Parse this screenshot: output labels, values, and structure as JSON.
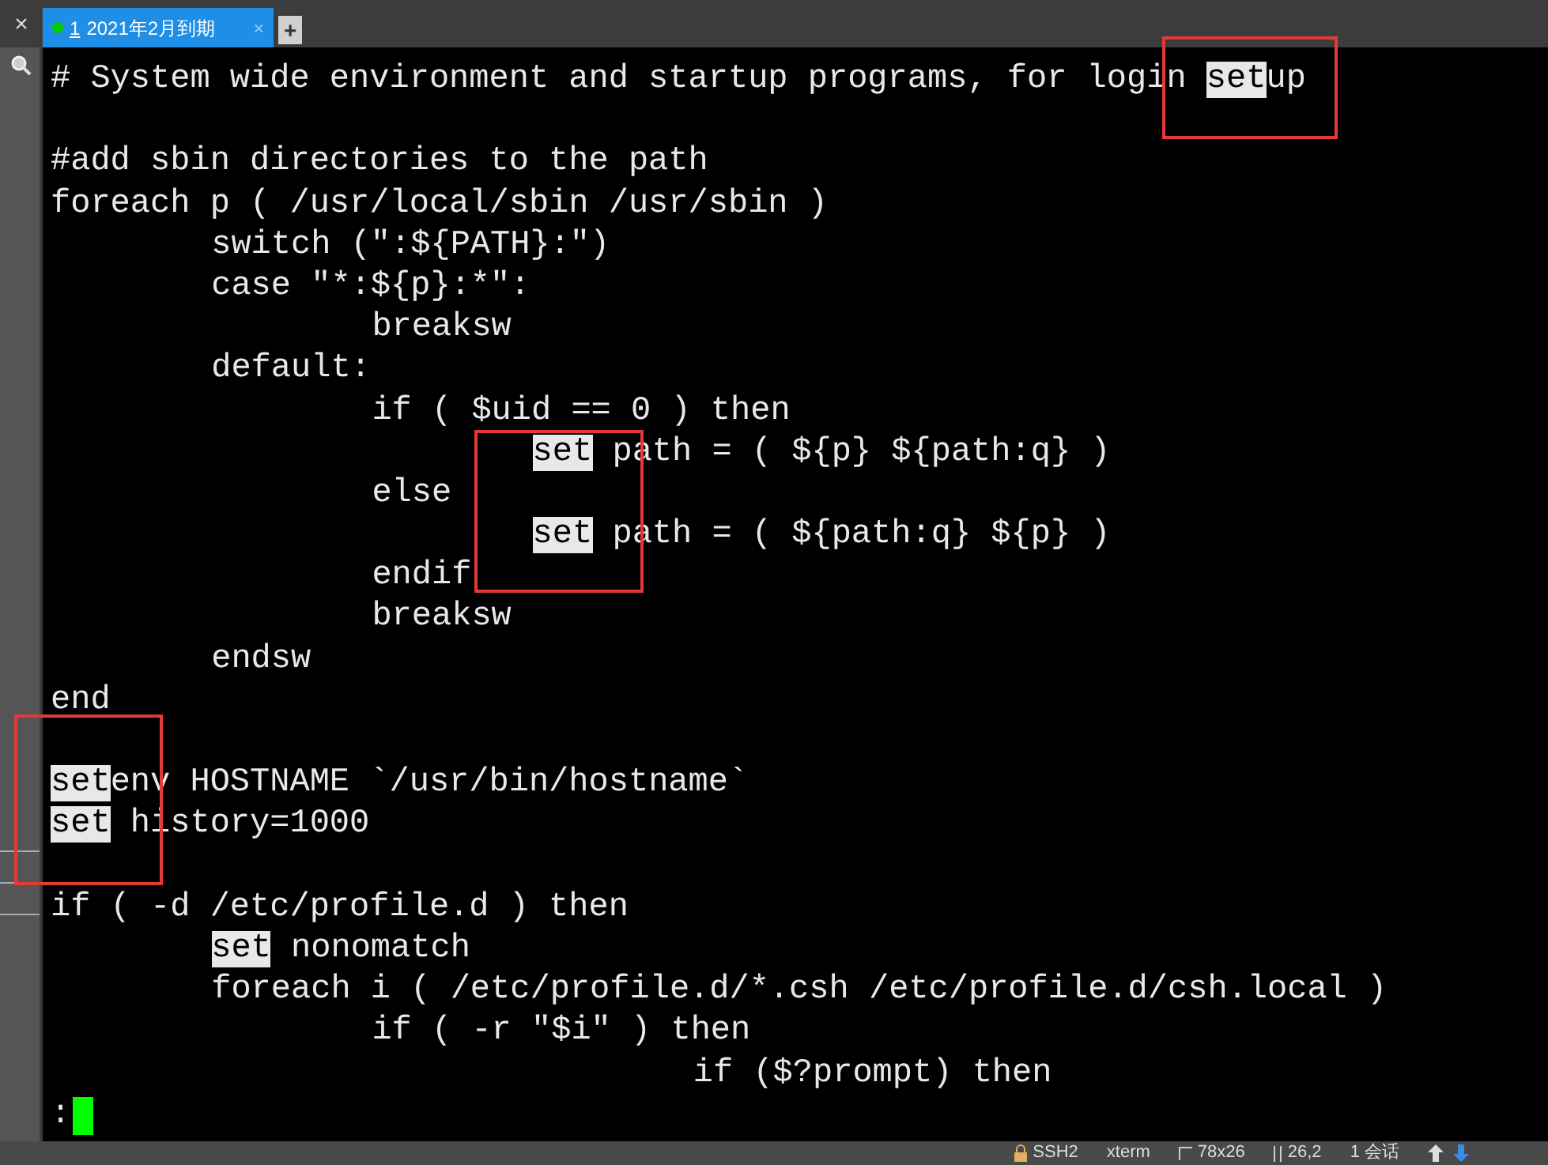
{
  "tabs": [
    {
      "number": "1",
      "label": "2021年2月到期",
      "close": "×",
      "selected": true,
      "connected": true
    }
  ],
  "new_tab": "+",
  "side_close": "×",
  "terminal": {
    "lines": [
      {
        "kind": "code",
        "segments": [
          {
            "text": "# System wide environment and startup programs, for login ",
            "highlighted": false
          },
          {
            "text": "set",
            "highlighted": true
          },
          {
            "text": "up",
            "highlighted": false
          }
        ]
      },
      {
        "kind": "blank"
      },
      {
        "kind": "code",
        "segments": [
          {
            "text": "#add sbin directories to the path",
            "highlighted": false
          }
        ]
      },
      {
        "kind": "code",
        "segments": [
          {
            "text": "foreach p ( /usr/local/sbin /usr/sbin )",
            "highlighted": false
          }
        ]
      },
      {
        "kind": "tab1",
        "segments": [
          {
            "text": "switch (\":${PATH}:\")",
            "highlighted": false
          }
        ]
      },
      {
        "kind": "tab1",
        "segments": [
          {
            "text": "case \"*:${p}:*\":",
            "highlighted": false
          }
        ]
      },
      {
        "kind": "tab2",
        "segments": [
          {
            "text": "breaksw",
            "highlighted": false
          }
        ]
      },
      {
        "kind": "tab1",
        "segments": [
          {
            "text": "default:",
            "highlighted": false
          }
        ]
      },
      {
        "kind": "tab2",
        "segments": [
          {
            "text": "if ( $uid == 0 ) then",
            "highlighted": false
          }
        ]
      },
      {
        "kind": "tab3",
        "segments": [
          {
            "text": "set",
            "highlighted": true
          },
          {
            "text": " path = ( ${p} ${path:q} )",
            "highlighted": false
          }
        ]
      },
      {
        "kind": "tab2",
        "segments": [
          {
            "text": "else",
            "highlighted": false
          }
        ]
      },
      {
        "kind": "tab3",
        "segments": [
          {
            "text": "set",
            "highlighted": true
          },
          {
            "text": " path = ( ${path:q} ${p} )",
            "highlighted": false
          }
        ]
      },
      {
        "kind": "tab2",
        "segments": [
          {
            "text": "endif",
            "highlighted": false
          }
        ]
      },
      {
        "kind": "tab2",
        "segments": [
          {
            "text": "breaksw",
            "highlighted": false
          }
        ]
      },
      {
        "kind": "tab1",
        "segments": [
          {
            "text": "endsw",
            "highlighted": false
          }
        ]
      },
      {
        "kind": "code",
        "segments": [
          {
            "text": "end",
            "highlighted": false
          }
        ]
      },
      {
        "kind": "blank"
      },
      {
        "kind": "code",
        "segments": [
          {
            "text": "set",
            "highlighted": true
          },
          {
            "text": "env HOSTNAME `/usr/bin/hostname`",
            "highlighted": false
          }
        ]
      },
      {
        "kind": "code",
        "segments": [
          {
            "text": "set",
            "highlighted": true
          },
          {
            "text": " history=1000",
            "highlighted": false
          }
        ]
      },
      {
        "kind": "blank"
      },
      {
        "kind": "code",
        "segments": [
          {
            "text": "if ( -d /etc/profile.d ) then",
            "highlighted": false
          }
        ]
      },
      {
        "kind": "tab1",
        "segments": [
          {
            "text": "set",
            "highlighted": true
          },
          {
            "text": " nonomatch",
            "highlighted": false
          }
        ]
      },
      {
        "kind": "tab1",
        "segments": [
          {
            "text": "foreach i ( /etc/profile.d/*.csh /etc/profile.d/csh.local )",
            "highlighted": false
          }
        ]
      },
      {
        "kind": "tab2",
        "segments": [
          {
            "text": "if ( -r \"$i\" ) then",
            "highlighted": false
          }
        ]
      },
      {
        "kind": "tab4",
        "segments": [
          {
            "text": "if ($?prompt) then",
            "highlighted": false
          }
        ]
      }
    ],
    "prompt": ":"
  },
  "status_bar": [
    {
      "kind": "lock",
      "text": "SSH2"
    },
    {
      "kind": "plain",
      "text": "xterm"
    },
    {
      "kind": "size",
      "text": "78x26"
    },
    {
      "kind": "cursor",
      "text": "26,2"
    },
    {
      "kind": "plain",
      "text": "1 会话"
    }
  ]
}
